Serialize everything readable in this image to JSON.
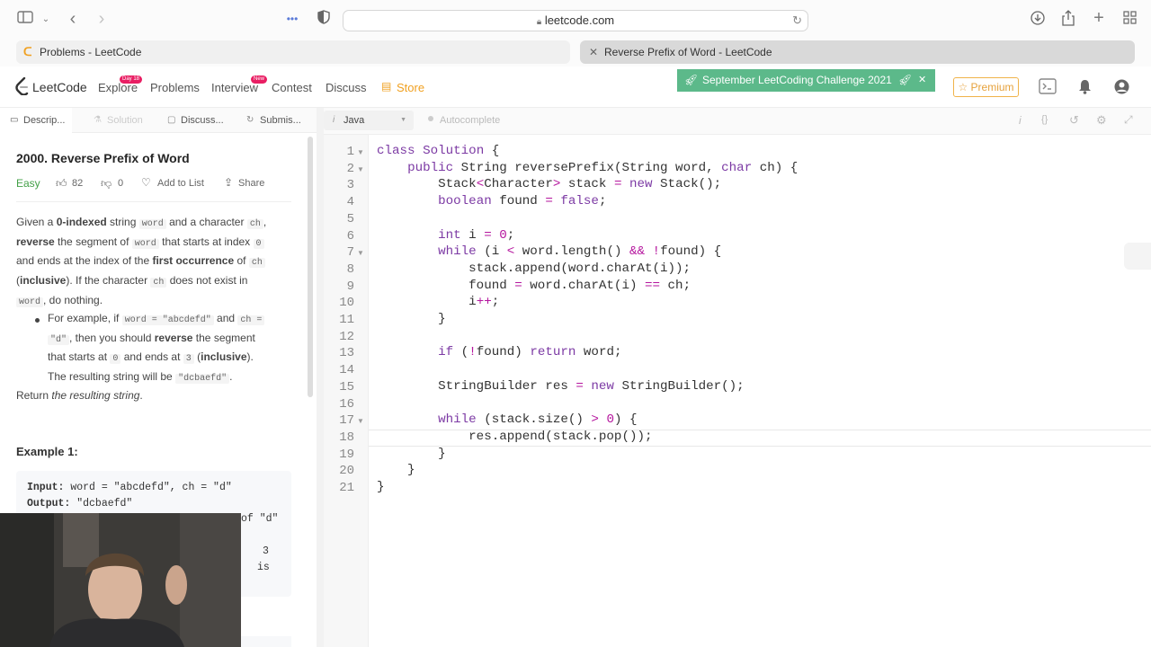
{
  "browser": {
    "url": "leetcode.com",
    "tabs": [
      {
        "title": "Problems - LeetCode"
      },
      {
        "title": "Reverse Prefix of Word - LeetCode"
      }
    ]
  },
  "nav": {
    "logo": "LeetCode",
    "links": [
      "Explore",
      "Problems",
      "Interview",
      "Contest",
      "Discuss",
      "Store"
    ],
    "explore_badge": "Day 18",
    "interview_badge": "New",
    "banner": "September LeetCoding Challenge 2021",
    "premium": "Premium"
  },
  "subtabs": [
    "Descrip...",
    "Solution",
    "Discuss...",
    "Submis..."
  ],
  "editor_bar": {
    "language": "Java",
    "autocomplete": "Autocomplete"
  },
  "problem": {
    "title": "2000. Reverse Prefix of Word",
    "difficulty": "Easy",
    "likes": "82",
    "dislikes": "0",
    "add_to_list": "Add to List",
    "share": "Share",
    "desc": {
      "p1a": "Given a ",
      "p1b": "0-indexed",
      "p1c": " string ",
      "p1d": "word",
      "p1e": " and a character ",
      "p1f": "ch",
      "p1g": ",",
      "p2a": "reverse",
      "p2b": " the segment of ",
      "p2c": "word",
      "p2d": " that starts at index ",
      "p2e": "0",
      "p3a": "and ends at the index of the ",
      "p3b": "first occurrence",
      "p3c": " of ",
      "p3d": "ch",
      "p4a": "(",
      "p4b": "inclusive",
      "p4c": "). If the character ",
      "p4d": "ch",
      "p4e": " does not exist in",
      "p5a": "word",
      "p5b": ", do nothing."
    },
    "bullet": {
      "b1a": "For example, if ",
      "b1b": "word = \"abcdefd\"",
      "b1c": " and ",
      "b1d": "ch =",
      "b2a": "\"d\"",
      "b2b": ", then you should ",
      "b2c": "reverse",
      "b2d": " the segment",
      "b3a": "that starts at ",
      "b3b": "0",
      "b3c": " and ends at ",
      "b3d": "3",
      "b3e": " (",
      "b3f": "inclusive",
      "b3g": ").",
      "b4a": "The resulting string will be ",
      "b4b": "\"dcbaefd\"",
      "b4c": "."
    },
    "return_a": "Return ",
    "return_b": "the resulting string",
    "return_c": ".",
    "example_title": "Example 1:",
    "example": {
      "input_label": "Input:",
      "input_value": " word = \"abcdefd\", ch = \"d\"",
      "output_label": "Output:",
      "output_value": " \"dcbaefd\"",
      "partial1": "of \"d\"",
      "partial2": "3",
      "partial3": "is"
    }
  },
  "code": {
    "line_numbers": [
      "1",
      "2",
      "3",
      "4",
      "5",
      "6",
      "7",
      "8",
      "9",
      "10",
      "11",
      "12",
      "13",
      "14",
      "15",
      "16",
      "17",
      "18",
      "19",
      "20",
      "21"
    ],
    "lines": [
      "class Solution {",
      "    public String reversePrefix(String word, char ch) {",
      "        Stack<Character> stack = new Stack();",
      "        boolean found = false;",
      "",
      "        int i = 0;",
      "        while (i < word.length() && !found) {",
      "            stack.append(word.charAt(i));",
      "            found = word.charAt(i) == ch;",
      "            i++;",
      "        }",
      "",
      "        if (!found) return word;",
      "",
      "        StringBuilder res = new StringBuilder();",
      "",
      "        while (stack.size() > 0) {",
      "            res.append(stack.pop());",
      "        }",
      "    }",
      "}"
    ]
  },
  "colors": {
    "banner": "#5cb98a",
    "premium": "#e6a23c",
    "store": "#f0a020",
    "keyword": "#7c3aa4",
    "operator": "#b5169e"
  }
}
